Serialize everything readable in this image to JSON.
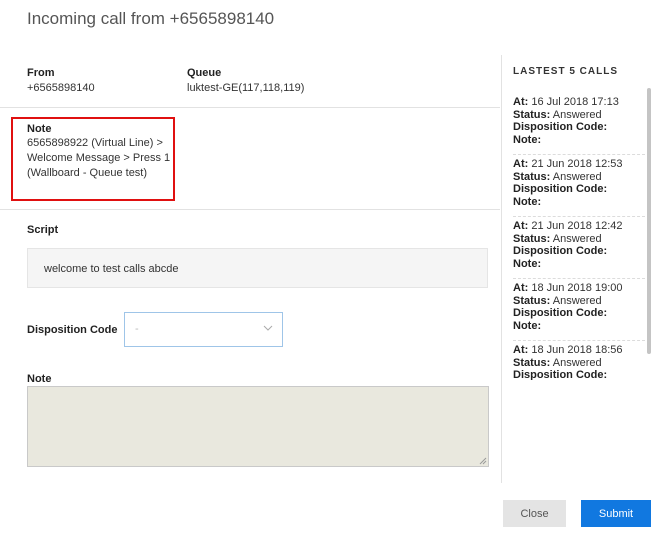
{
  "dialog": {
    "title": "Incoming call from +6565898140"
  },
  "call_info": {
    "from_label": "From",
    "from_value": "+6565898140",
    "queue_label": "Queue",
    "queue_value": "luktest-GE(117,118,119)",
    "note_label": "Note",
    "note_value": "6565898922 (Virtual Line) > Welcome Message > Press 1 (Wallboard - Queue test)"
  },
  "script": {
    "label": "Script",
    "text": "welcome to test calls abcde"
  },
  "disposition": {
    "label": "Disposition Code",
    "selected": "-"
  },
  "note_input": {
    "label": "Note",
    "value": ""
  },
  "last_calls": {
    "title": "LASTEST 5 CALLS",
    "at_label": "At:",
    "status_label": "Status:",
    "disposition_label": "Disposition Code:",
    "note_label": "Note:",
    "items": [
      {
        "at": "16 Jul 2018 17:13",
        "status": "Answered",
        "disposition": "",
        "note": ""
      },
      {
        "at": "21 Jun 2018 12:53",
        "status": "Answered",
        "disposition": "",
        "note": ""
      },
      {
        "at": "21 Jun 2018 12:42",
        "status": "Answered",
        "disposition": "",
        "note": ""
      },
      {
        "at": "18 Jun 2018 19:00",
        "status": "Answered",
        "disposition": "",
        "note": ""
      },
      {
        "at": "18 Jun 2018 18:56",
        "status": "Answered",
        "disposition": "",
        "note": ""
      }
    ]
  },
  "buttons": {
    "close": "Close",
    "submit": "Submit"
  },
  "colors": {
    "highlight": "#e01010",
    "primary": "#1178e0"
  }
}
